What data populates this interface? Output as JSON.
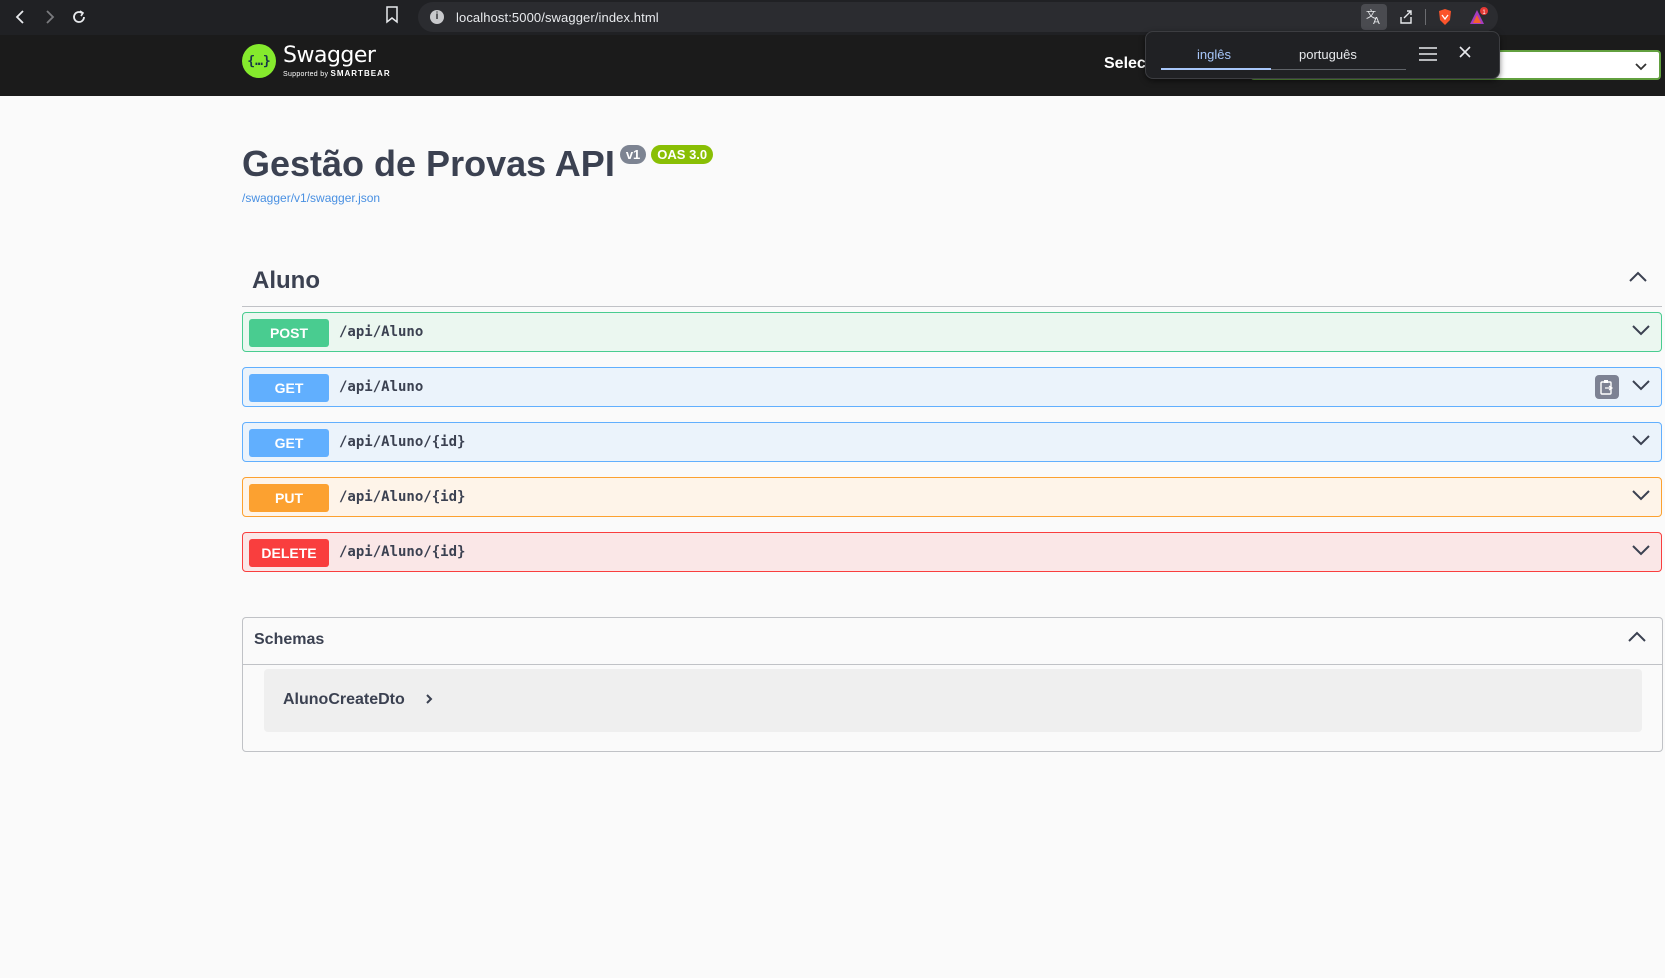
{
  "browser": {
    "url": "localhost:5000/swagger/index.html",
    "notification_count": "1"
  },
  "translate_popup": {
    "tab_source": "inglês",
    "tab_target": "português"
  },
  "topbar": {
    "logo_title": "Swagger",
    "logo_sub_prefix": "Supported by",
    "logo_sub_brand": "SMARTBEAR",
    "select_label": "Selec"
  },
  "info": {
    "title": "Gestão de Provas API",
    "version_badge": "v1",
    "oas_badge": "OAS 3.0",
    "spec_url": "/swagger/v1/swagger.json"
  },
  "tag": {
    "name": "Aluno",
    "operations": [
      {
        "method": "POST",
        "path": "/api/Aluno"
      },
      {
        "method": "GET",
        "path": "/api/Aluno"
      },
      {
        "method": "GET",
        "path": "/api/Aluno/{id}"
      },
      {
        "method": "PUT",
        "path": "/api/Aluno/{id}"
      },
      {
        "method": "DELETE",
        "path": "/api/Aluno/{id}"
      }
    ]
  },
  "schemas": {
    "title": "Schemas",
    "models": [
      {
        "name": "AlunoCreateDto"
      }
    ]
  },
  "colors": {
    "post": "#49cc90",
    "get": "#61affe",
    "put": "#fca130",
    "delete": "#f93e3e",
    "swagger_green": "#85ea2d"
  }
}
